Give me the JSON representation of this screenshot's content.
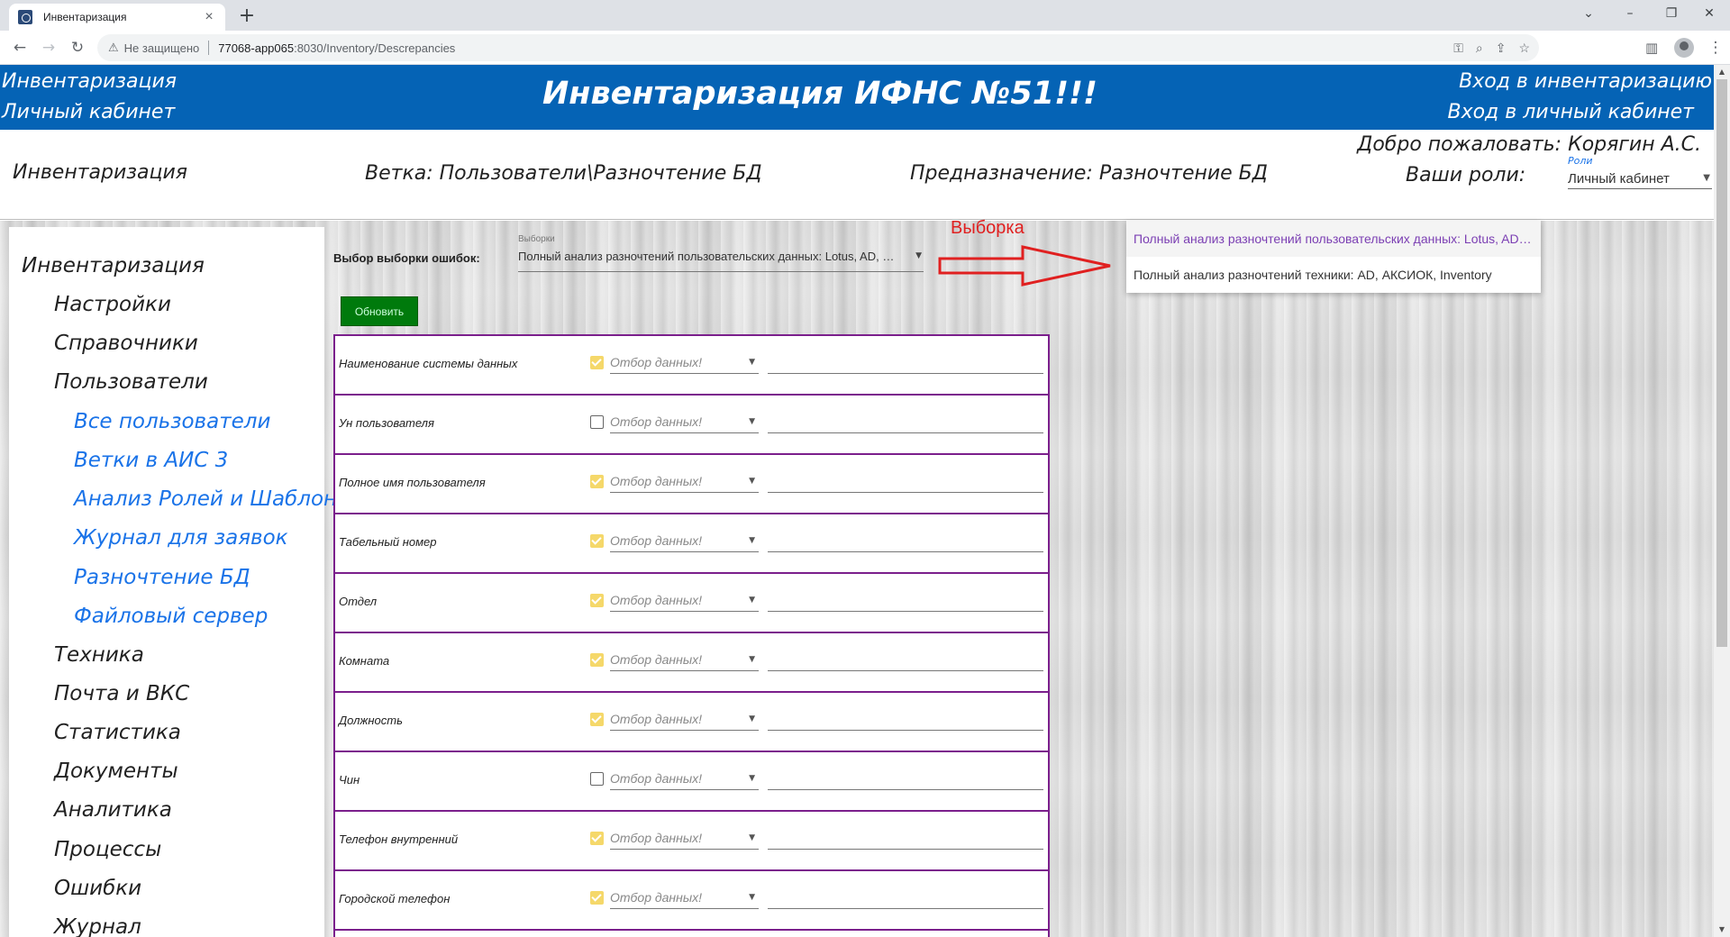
{
  "browser": {
    "tab_title": "Инвентаризация",
    "insecure_label": "Не защищено",
    "url_host": "77068-app065",
    "url_path": ":8030/Inventory/Descrepancies"
  },
  "banner": {
    "left_top": "Инвентаризация",
    "left_bottom": "Личный кабинет",
    "title": "Инвентаризация ИФНС №51!!!",
    "right_top": "Вход в инвентаризацию",
    "right_bottom": "Вход в личный кабинет"
  },
  "info": {
    "section": "Инвентаризация",
    "branch": "Ветка: Пользователи\\Разночтение БД",
    "purpose": "Предназначение: Разночтение БД",
    "welcome": "Добро пожаловать: Корягин А.С.",
    "roles_label": "Ваши роли:",
    "roles_select_label": "Роли",
    "roles_select_value": "Личный кабинет"
  },
  "sidebar": {
    "items": [
      {
        "label": "Инвентаризация"
      },
      {
        "label": "Настройки"
      },
      {
        "label": "Справочники"
      },
      {
        "label": "Пользователи"
      },
      {
        "label": "Все пользователи"
      },
      {
        "label": "Ветки в АИС 3"
      },
      {
        "label": "Анализ Ролей и Шаблонов"
      },
      {
        "label": "Журнал для заявок"
      },
      {
        "label": "Разночтение БД"
      },
      {
        "label": "Файловый сервер"
      },
      {
        "label": "Техника"
      },
      {
        "label": "Почта и ВКС"
      },
      {
        "label": "Статистика"
      },
      {
        "label": "Документы"
      },
      {
        "label": "Аналитика"
      },
      {
        "label": "Процессы"
      },
      {
        "label": "Ошибки"
      },
      {
        "label": "Журнал"
      }
    ]
  },
  "main": {
    "select_label": "Выбор выборки ошибок:",
    "samples_select_label": "Выборки",
    "samples_select_value": "Полный анализ разночтений пользовательских данных: Lotus, AD, АКСИОК",
    "refresh_label": "Обновить",
    "annotation": "Выборка",
    "dropdown_options": [
      "Полный анализ разночтений пользовательских данных: Lotus, AD, АКСИОК, Inventory",
      "Полный анализ разночтений техники: AD, АКСИОК, Inventory"
    ],
    "filter_placeholder": "Отбор данных!",
    "rows": [
      {
        "name": "Наименование системы данных",
        "checked": true
      },
      {
        "name": "Ун пользователя",
        "checked": false
      },
      {
        "name": "Полное имя пользователя",
        "checked": true
      },
      {
        "name": "Табельный номер",
        "checked": true
      },
      {
        "name": "Отдел",
        "checked": true
      },
      {
        "name": "Комната",
        "checked": true
      },
      {
        "name": "Должность",
        "checked": true
      },
      {
        "name": "Чин",
        "checked": false
      },
      {
        "name": "Телефон внутренний",
        "checked": true
      },
      {
        "name": "Городской телефон",
        "checked": true
      }
    ]
  },
  "colors": {
    "banner": "#0563b5",
    "refresh_button": "#007a0c",
    "table_border": "#7b1f8c",
    "checkbox_on": "#f5d86a",
    "sidebar_sub": "#1a73e8",
    "annotation": "#e02020"
  }
}
